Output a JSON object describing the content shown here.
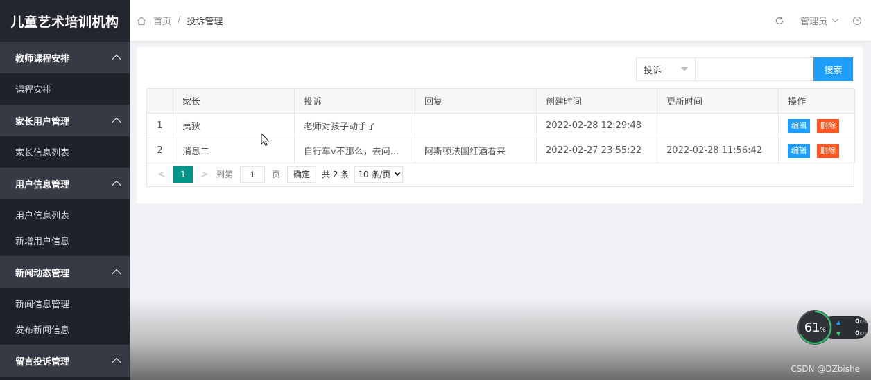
{
  "sidebar": {
    "brand": "儿童艺术培训机构",
    "groups": [
      {
        "title": "教师课程安排",
        "items": [
          "课程安排"
        ]
      },
      {
        "title": "家长用户管理",
        "items": [
          "家长信息列表"
        ]
      },
      {
        "title": "用户信息管理",
        "items": [
          "用户信息列表",
          "新增用户信息"
        ]
      },
      {
        "title": "新闻动态管理",
        "items": [
          "新闻信息管理",
          "发布新闻信息"
        ]
      },
      {
        "title": "留言投诉管理",
        "items": []
      }
    ]
  },
  "topbar": {
    "breadcrumb_home": "首页",
    "breadcrumb_sep": "/",
    "breadcrumb_current": "投诉管理",
    "user": "管理员"
  },
  "search": {
    "field": "投诉",
    "value": "",
    "button": "搜索"
  },
  "table": {
    "columns": [
      "",
      "家长",
      "投诉",
      "回复",
      "创建时间",
      "更新时间",
      "操作"
    ],
    "rows": [
      {
        "no": "1",
        "parent": "夷狄",
        "complaint": "老师对孩子动手了",
        "reply": "",
        "created": "2022-02-28 12:29:48",
        "updated": ""
      },
      {
        "no": "2",
        "parent": "消息二",
        "complaint": "自行车v不那么，去问...",
        "reply": "阿斯顿法国红酒看来",
        "created": "2022-02-27 23:55:22",
        "updated": "2022-02-28 11:56:42"
      }
    ],
    "edit_label": "编辑",
    "delete_label": "删除"
  },
  "pager": {
    "prev": "<",
    "current": "1",
    "next": ">",
    "goto_label": "到第",
    "page_input": "1",
    "page_unit": "页",
    "confirm": "确定",
    "total": "共 2 条",
    "page_size": "10 条/页"
  },
  "net_widget": {
    "cpu": "61",
    "cpu_unit": "%",
    "up": "0",
    "down": "0",
    "unit": "K/s"
  },
  "watermark": "CSDN @DZbishe"
}
